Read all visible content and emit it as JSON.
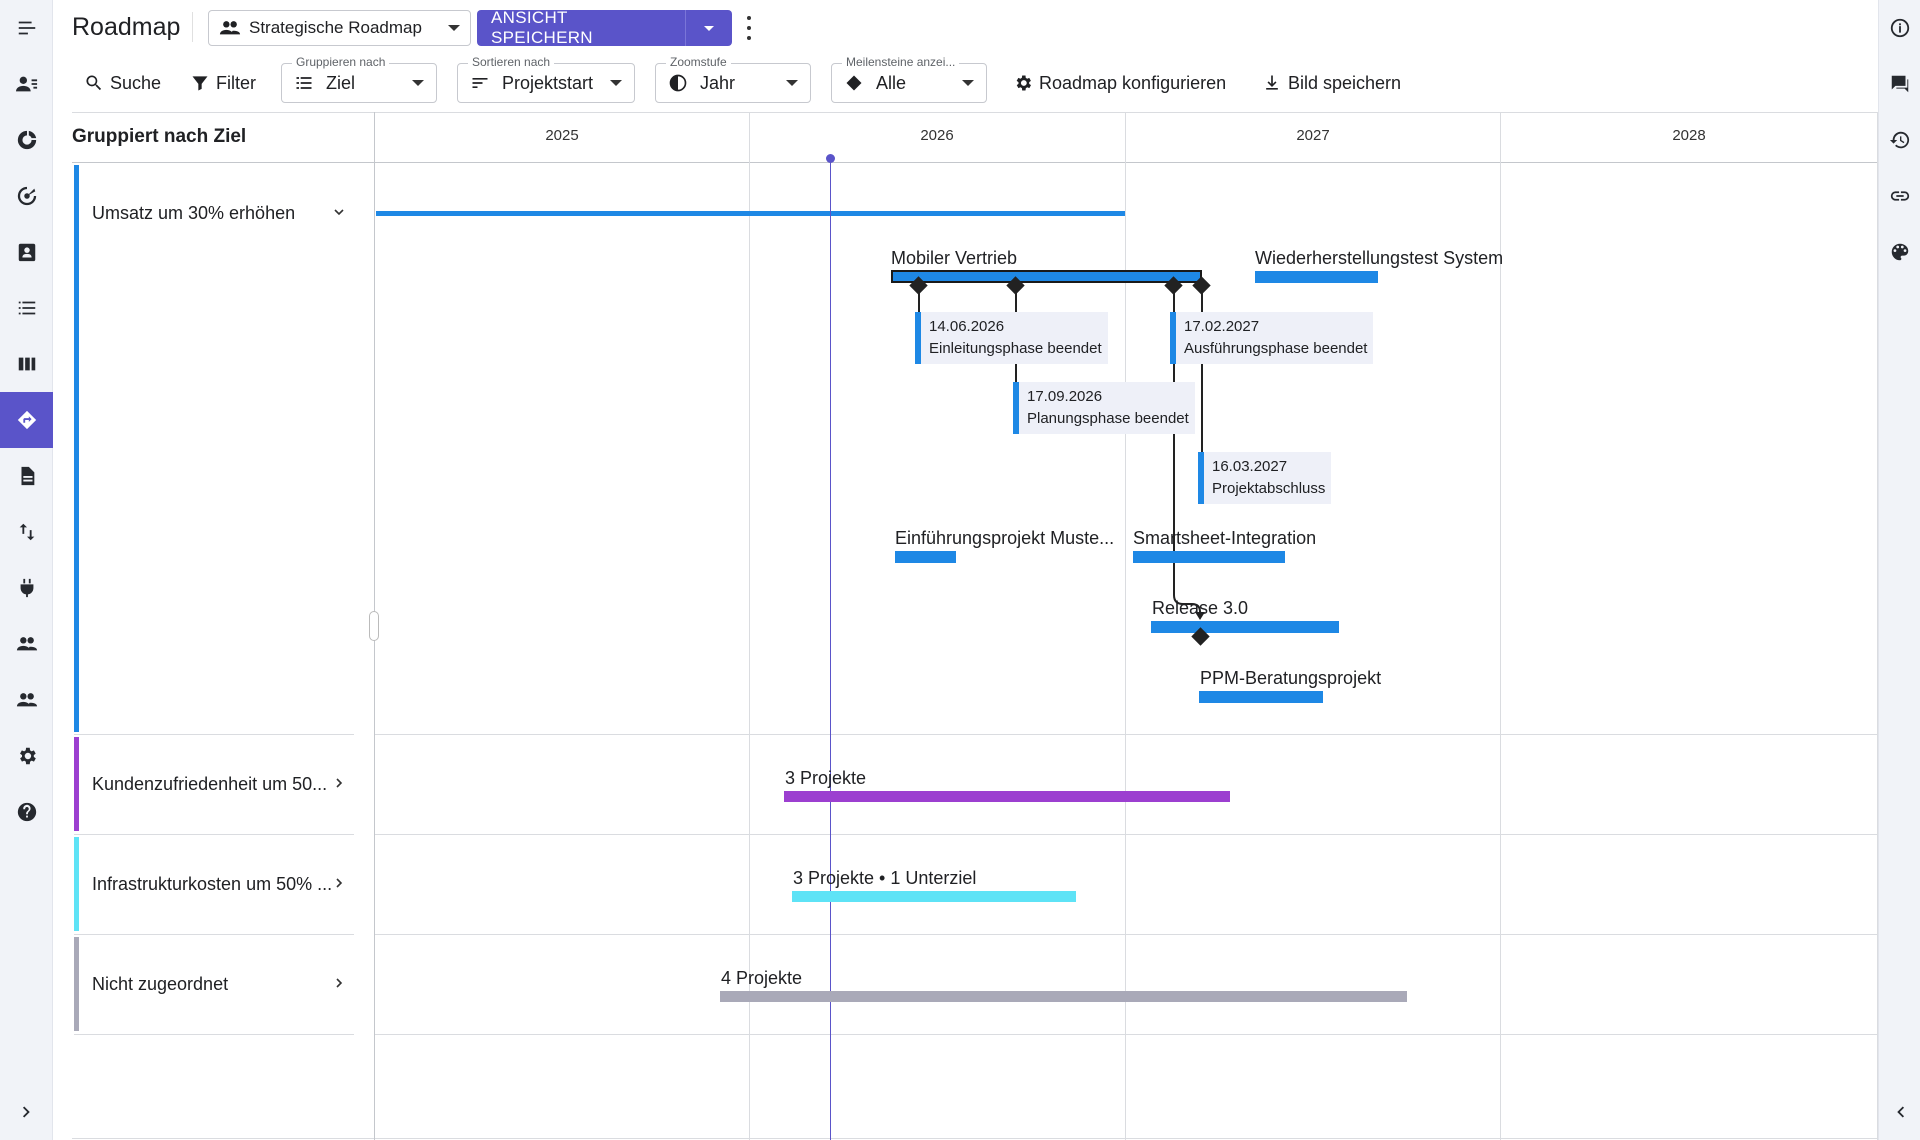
{
  "header": {
    "title": "Roadmap",
    "view_name": "Strategische Roadmap",
    "save_view_label": "ANSICHT SPEICHERN"
  },
  "toolbar": {
    "search_label": "Suche",
    "filter_label": "Filter",
    "group_by": {
      "label": "Gruppieren nach",
      "value": "Ziel"
    },
    "sort_by": {
      "label": "Sortieren nach",
      "value": "Projektstart"
    },
    "zoom": {
      "label": "Zoomstufe",
      "value": "Jahr"
    },
    "milestones": {
      "label": "Meilensteine anzei...",
      "value": "Alle"
    },
    "configure_label": "Roadmap konfigurieren",
    "save_image_label": "Bild speichern"
  },
  "grid": {
    "left_header": "Gruppiert nach Ziel",
    "years": [
      "2025",
      "2026",
      "2027",
      "2028"
    ]
  },
  "groups": [
    {
      "label": "Umsatz um 30% erhöhen",
      "color": "#1e88e5",
      "expanded": true
    },
    {
      "label": "Kundenzufriedenheit um 50...",
      "color": "#9c3fd0",
      "expanded": false
    },
    {
      "label": "Infrastrukturkosten um 50% ...",
      "color": "#5ee3f6",
      "expanded": false
    },
    {
      "label": "Nicht zugeordnet",
      "color": "#a9a9b8",
      "expanded": false
    }
  ],
  "items": {
    "mobiler_vertrieb": "Mobiler Vertrieb",
    "wiederherstellungstest": "Wiederherstellungstest System",
    "einfuehrungsprojekt": "Einführungsprojekt Muste...",
    "smartsheet": "Smartsheet-Integration",
    "release": "Release 3.0",
    "ppm": "PPM-Beratungsprojekt",
    "kunden_summary": "3 Projekte",
    "infra_summary": "3 Projekte • 1 Unterziel",
    "nicht_summary": "4 Projekte"
  },
  "milestones": [
    {
      "date": "14.06.2026",
      "name": "Einleitungsphase beendet"
    },
    {
      "date": "17.09.2026",
      "name": "Planungsphase beendet"
    },
    {
      "date": "17.02.2027",
      "name": "Ausführungsphase beendet"
    },
    {
      "date": "16.03.2027",
      "name": "Projektabschluss"
    }
  ],
  "colors": {
    "accent": "#5a54c9",
    "project_blue": "#1e88e5",
    "today_line": "#5a54c9"
  }
}
